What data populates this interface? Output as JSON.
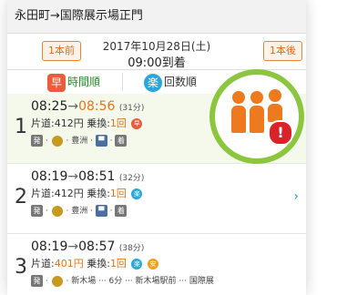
{
  "header": {
    "route": "永田町→国際展示場正門"
  },
  "date_nav": {
    "prev_label": "1本前",
    "next_label": "1本後",
    "date": "2017年10月28日(土)",
    "arrival": "09:00到着"
  },
  "sort_tabs": [
    {
      "icon": "早",
      "label": "時間順",
      "color": "#e95d3c"
    },
    {
      "icon": "楽",
      "label": "回数順",
      "color": "#2aa6d9"
    },
    {
      "icon": "",
      "label": "順",
      "color": ""
    }
  ],
  "results": [
    {
      "index": "1",
      "depart": "08:25",
      "arrive": "08:56",
      "duration": "(31分)",
      "fare": "片道:412円",
      "transfers_label": "乗換:",
      "transfers": "1回",
      "route_text": "豊洲",
      "badge": "早",
      "badge_color": "#e95d3c"
    },
    {
      "index": "2",
      "depart": "08:19",
      "arrive": "08:51",
      "duration": "(32分)",
      "fare": "片道:412円",
      "transfers_label": "乗換:",
      "transfers": "1回",
      "route_text": "豊洲",
      "badge": "楽",
      "badge_color": "#2aa6d9"
    },
    {
      "index": "3",
      "depart": "08:19",
      "arrive": "08:57",
      "duration": "(38分)",
      "fare_prefix": "片道:",
      "fare_value": "401円",
      "transfers_label": "乗換:",
      "transfers": "1回",
      "route_text": "新木場 ··· 6分 ··· 新木場駅前 ··· 国際展",
      "badge": "楽",
      "badge_color": "#2aa6d9",
      "badge2": "安",
      "badge2_color": "#f0a020"
    }
  ],
  "route_labels": {
    "start": "発",
    "end": "着",
    "line": "Y"
  },
  "overlay": {
    "alert": "!"
  }
}
